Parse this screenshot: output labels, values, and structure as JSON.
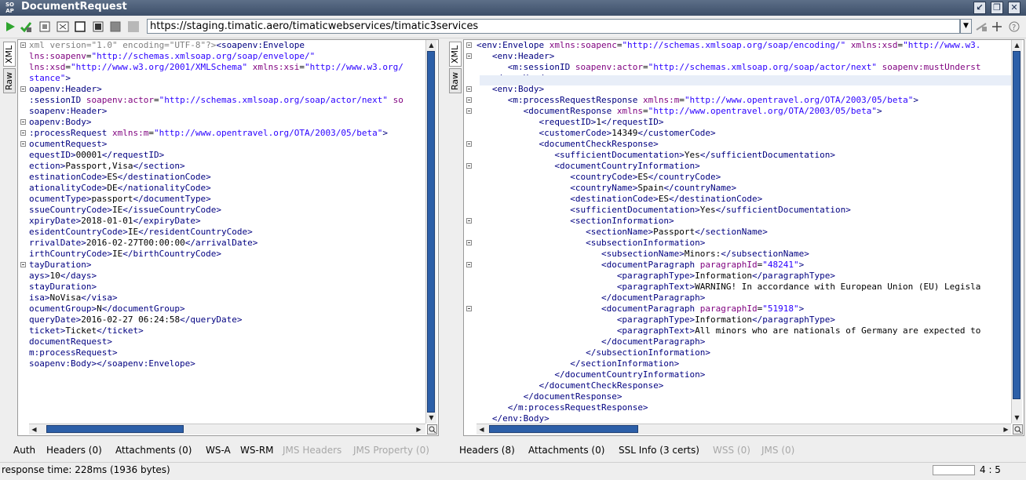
{
  "window": {
    "title": "DocumentRequest",
    "logo_text": "SO AP"
  },
  "toolbar": {
    "url": "https://staging.timatic.aero/timaticwebservices/timatic3services"
  },
  "left_pane": {
    "tabs": [
      "XML",
      "Raw"
    ],
    "lines": [
      [
        [
          "gy",
          "xml version=\"1.0\" encoding=\"UTF-8\"?>"
        ],
        [
          "t",
          "<soapenv:Envelope"
        ]
      ],
      [
        [
          "an",
          "lns:soapenv"
        ],
        [
          "tx",
          "="
        ],
        [
          "av",
          "\"http://schemas.xmlsoap.org/soap/envelope/\""
        ]
      ],
      [
        [
          "an",
          "lns:xsd"
        ],
        [
          "tx",
          "="
        ],
        [
          "av",
          "\"http://www.w3.org/2001/XMLSchema\""
        ],
        [
          "tx",
          " "
        ],
        [
          "an",
          "xmlns:xsi"
        ],
        [
          "tx",
          "="
        ],
        [
          "av",
          "\"http://www.w3.org/"
        ]
      ],
      [
        [
          "av",
          "stance\""
        ],
        [
          "t",
          ">"
        ]
      ],
      [
        [
          "t",
          "oapenv:Header>"
        ]
      ],
      [
        [
          "t",
          ":sessionID"
        ],
        [
          "tx",
          " "
        ],
        [
          "an",
          "soapenv:actor"
        ],
        [
          "tx",
          "="
        ],
        [
          "av",
          "\"http://schemas.xmlsoap.org/soap/actor/next\""
        ],
        [
          "tx",
          " "
        ],
        [
          "an",
          "so"
        ]
      ],
      [
        [
          "t",
          "soapenv:Header>"
        ]
      ],
      [
        [
          "t",
          "oapenv:Body>"
        ]
      ],
      [
        [
          "t",
          ":processRequest"
        ],
        [
          "tx",
          " "
        ],
        [
          "an",
          "xmlns:m"
        ],
        [
          "tx",
          "="
        ],
        [
          "av",
          "\"http://www.opentravel.org/OTA/2003/05/beta\""
        ],
        [
          "t",
          ">"
        ]
      ],
      [
        [
          "t",
          "ocumentRequest>"
        ]
      ],
      [
        [
          "t",
          "equestID>"
        ],
        [
          "tx",
          "00001"
        ],
        [
          "t",
          "</requestID>"
        ]
      ],
      [
        [
          "t",
          "ection>"
        ],
        [
          "tx",
          "Passport,Visa"
        ],
        [
          "t",
          "</section>"
        ]
      ],
      [
        [
          "t",
          "estinationCode>"
        ],
        [
          "tx",
          "ES"
        ],
        [
          "t",
          "</destinationCode>"
        ]
      ],
      [
        [
          "t",
          "ationalityCode>"
        ],
        [
          "tx",
          "DE"
        ],
        [
          "t",
          "</nationalityCode>"
        ]
      ],
      [
        [
          "t",
          "ocumentType>"
        ],
        [
          "tx",
          "passport"
        ],
        [
          "t",
          "</documentType>"
        ]
      ],
      [
        [
          "t",
          "ssueCountryCode>"
        ],
        [
          "tx",
          "IE"
        ],
        [
          "t",
          "</issueCountryCode>"
        ]
      ],
      [
        [
          "t",
          "xpiryDate>"
        ],
        [
          "tx",
          "2018-01-01"
        ],
        [
          "t",
          "</expiryDate>"
        ]
      ],
      [
        [
          "t",
          "esidentCountryCode>"
        ],
        [
          "tx",
          "IE"
        ],
        [
          "t",
          "</residentCountryCode>"
        ]
      ],
      [
        [
          "t",
          "rrivalDate>"
        ],
        [
          "tx",
          "2016-02-27T00:00:00"
        ],
        [
          "t",
          "</arrivalDate>"
        ]
      ],
      [
        [
          "t",
          "irthCountryCode>"
        ],
        [
          "tx",
          "IE"
        ],
        [
          "t",
          "</birthCountryCode>"
        ]
      ],
      [
        [
          "t",
          "tayDuration>"
        ]
      ],
      [
        [
          "t",
          "ays>"
        ],
        [
          "tx",
          "10"
        ],
        [
          "t",
          "</days>"
        ]
      ],
      [
        [
          "t",
          "stayDuration>"
        ]
      ],
      [
        [
          "t",
          "isa>"
        ],
        [
          "tx",
          "NoVisa"
        ],
        [
          "t",
          "</visa>"
        ]
      ],
      [
        [
          "t",
          "ocumentGroup>"
        ],
        [
          "tx",
          "N"
        ],
        [
          "t",
          "</documentGroup>"
        ]
      ],
      [
        [
          "t",
          "queryDate>"
        ],
        [
          "tx",
          "2016-02-27 06:24:58"
        ],
        [
          "t",
          "</queryDate>"
        ]
      ],
      [
        [
          "t",
          "ticket>"
        ],
        [
          "tx",
          "Ticket"
        ],
        [
          "t",
          "</ticket>"
        ]
      ],
      [
        [
          "t",
          "documentRequest>"
        ]
      ],
      [
        [
          "t",
          "m:processRequest>"
        ]
      ],
      [
        [
          "t",
          "soapenv:Body></soapenv:Envelope>"
        ]
      ]
    ],
    "bottom_tabs": [
      {
        "label": "Auth",
        "disabled": false
      },
      {
        "label": "Headers (0)",
        "disabled": false
      },
      {
        "label": "Attachments (0)",
        "disabled": false
      },
      {
        "label": "WS-A",
        "disabled": false
      },
      {
        "label": "WS-RM",
        "disabled": false
      },
      {
        "label": "JMS Headers",
        "disabled": true
      },
      {
        "label": "JMS Property (0)",
        "disabled": true
      }
    ]
  },
  "right_pane": {
    "tabs": [
      "XML",
      "Raw"
    ],
    "lines": [
      [
        [
          "t",
          "<env:Envelope"
        ],
        [
          "tx",
          " "
        ],
        [
          "an",
          "xmlns:soapenc"
        ],
        [
          "tx",
          "="
        ],
        [
          "av",
          "\"http://schemas.xmlsoap.org/soap/encoding/\""
        ],
        [
          "tx",
          " "
        ],
        [
          "an",
          "xmlns:xsd"
        ],
        [
          "tx",
          "="
        ],
        [
          "av",
          "\"http://www.w3."
        ]
      ],
      [
        [
          "tx",
          "   "
        ],
        [
          "t",
          "<env:Header>"
        ]
      ],
      [
        [
          "tx",
          "      "
        ],
        [
          "t",
          "<m:sessionID"
        ],
        [
          "tx",
          " "
        ],
        [
          "an",
          "soapenv:actor"
        ],
        [
          "tx",
          "="
        ],
        [
          "av",
          "\"http://schemas.xmlsoap.org/soap/actor/next\""
        ],
        [
          "tx",
          " "
        ],
        [
          "an",
          "soapenv:mustUnderst"
        ]
      ],
      [
        [
          "tx",
          "   "
        ],
        [
          "t",
          "</env:Header>"
        ]
      ],
      [
        [
          "tx",
          "   "
        ],
        [
          "t",
          "<env:Body>"
        ]
      ],
      [
        [
          "tx",
          "      "
        ],
        [
          "t",
          "<m:processRequestResponse"
        ],
        [
          "tx",
          " "
        ],
        [
          "an",
          "xmlns:m"
        ],
        [
          "tx",
          "="
        ],
        [
          "av",
          "\"http://www.opentravel.org/OTA/2003/05/beta\""
        ],
        [
          "t",
          ">"
        ]
      ],
      [
        [
          "tx",
          "         "
        ],
        [
          "t",
          "<documentResponse"
        ],
        [
          "tx",
          " "
        ],
        [
          "an",
          "xmlns"
        ],
        [
          "tx",
          "="
        ],
        [
          "av",
          "\"http://www.opentravel.org/OTA/2003/05/beta\""
        ],
        [
          "t",
          ">"
        ]
      ],
      [
        [
          "tx",
          "            "
        ],
        [
          "t",
          "<requestID>"
        ],
        [
          "tx",
          "1"
        ],
        [
          "t",
          "</requestID>"
        ]
      ],
      [
        [
          "tx",
          "            "
        ],
        [
          "t",
          "<customerCode>"
        ],
        [
          "tx",
          "14349"
        ],
        [
          "t",
          "</customerCode>"
        ]
      ],
      [
        [
          "tx",
          "            "
        ],
        [
          "t",
          "<documentCheckResponse>"
        ]
      ],
      [
        [
          "tx",
          "               "
        ],
        [
          "t",
          "<sufficientDocumentation>"
        ],
        [
          "tx",
          "Yes"
        ],
        [
          "t",
          "</sufficientDocumentation>"
        ]
      ],
      [
        [
          "tx",
          "               "
        ],
        [
          "t",
          "<documentCountryInformation>"
        ]
      ],
      [
        [
          "tx",
          "                  "
        ],
        [
          "t",
          "<countryCode>"
        ],
        [
          "tx",
          "ES"
        ],
        [
          "t",
          "</countryCode>"
        ]
      ],
      [
        [
          "tx",
          "                  "
        ],
        [
          "t",
          "<countryName>"
        ],
        [
          "tx",
          "Spain"
        ],
        [
          "t",
          "</countryName>"
        ]
      ],
      [
        [
          "tx",
          "                  "
        ],
        [
          "t",
          "<destinationCode>"
        ],
        [
          "tx",
          "ES"
        ],
        [
          "t",
          "</destinationCode>"
        ]
      ],
      [
        [
          "tx",
          "                  "
        ],
        [
          "t",
          "<sufficientDocumentation>"
        ],
        [
          "tx",
          "Yes"
        ],
        [
          "t",
          "</sufficientDocumentation>"
        ]
      ],
      [
        [
          "tx",
          "                  "
        ],
        [
          "t",
          "<sectionInformation>"
        ]
      ],
      [
        [
          "tx",
          "                     "
        ],
        [
          "t",
          "<sectionName>"
        ],
        [
          "tx",
          "Passport"
        ],
        [
          "t",
          "</sectionName>"
        ]
      ],
      [
        [
          "tx",
          "                     "
        ],
        [
          "t",
          "<subsectionInformation>"
        ]
      ],
      [
        [
          "tx",
          "                        "
        ],
        [
          "t",
          "<subsectionName>"
        ],
        [
          "tx",
          "Minors:"
        ],
        [
          "t",
          "</subsectionName>"
        ]
      ],
      [
        [
          "tx",
          "                        "
        ],
        [
          "t",
          "<documentParagraph"
        ],
        [
          "tx",
          " "
        ],
        [
          "an",
          "paragraphId"
        ],
        [
          "tx",
          "="
        ],
        [
          "av",
          "\"48241\""
        ],
        [
          "t",
          ">"
        ]
      ],
      [
        [
          "tx",
          "                           "
        ],
        [
          "t",
          "<paragraphType>"
        ],
        [
          "tx",
          "Information"
        ],
        [
          "t",
          "</paragraphType>"
        ]
      ],
      [
        [
          "tx",
          "                           "
        ],
        [
          "t",
          "<paragraphText>"
        ],
        [
          "tx",
          "WARNING! In accordance with European Union (EU) Legisla"
        ]
      ],
      [
        [
          "tx",
          "                        "
        ],
        [
          "t",
          "</documentParagraph>"
        ]
      ],
      [
        [
          "tx",
          "                        "
        ],
        [
          "t",
          "<documentParagraph"
        ],
        [
          "tx",
          " "
        ],
        [
          "an",
          "paragraphId"
        ],
        [
          "tx",
          "="
        ],
        [
          "av",
          "\"51918\""
        ],
        [
          "t",
          ">"
        ]
      ],
      [
        [
          "tx",
          "                           "
        ],
        [
          "t",
          "<paragraphType>"
        ],
        [
          "tx",
          "Information"
        ],
        [
          "t",
          "</paragraphType>"
        ]
      ],
      [
        [
          "tx",
          "                           "
        ],
        [
          "t",
          "<paragraphText>"
        ],
        [
          "tx",
          "All minors who are nationals of Germany are expected to"
        ]
      ],
      [
        [
          "tx",
          "                        "
        ],
        [
          "t",
          "</documentParagraph>"
        ]
      ],
      [
        [
          "tx",
          "                     "
        ],
        [
          "t",
          "</subsectionInformation>"
        ]
      ],
      [
        [
          "tx",
          "                  "
        ],
        [
          "t",
          "</sectionInformation>"
        ]
      ],
      [
        [
          "tx",
          "               "
        ],
        [
          "t",
          "</documentCountryInformation>"
        ]
      ],
      [
        [
          "tx",
          "            "
        ],
        [
          "t",
          "</documentCheckResponse>"
        ]
      ],
      [
        [
          "tx",
          "         "
        ],
        [
          "t",
          "</documentResponse>"
        ]
      ],
      [
        [
          "tx",
          "      "
        ],
        [
          "t",
          "</m:processRequestResponse>"
        ]
      ],
      [
        [
          "tx",
          "   "
        ],
        [
          "t",
          "</env:Body>"
        ]
      ]
    ],
    "bottom_tabs": [
      {
        "label": "Headers (8)",
        "disabled": false
      },
      {
        "label": "Attachments (0)",
        "disabled": false
      },
      {
        "label": "SSL Info (3 certs)",
        "disabled": false
      },
      {
        "label": "WSS (0)",
        "disabled": true
      },
      {
        "label": "JMS (0)",
        "disabled": true
      }
    ]
  },
  "status": {
    "response_time": "response time: 228ms (1936 bytes)",
    "cursor_position": "4 : 5"
  },
  "colors": {
    "tag": "#000080",
    "attr_name": "#7f007f",
    "attr_value": "#2a00ff",
    "title_bar": "#4a5c77",
    "scroll_thumb": "#2c5fa8"
  }
}
